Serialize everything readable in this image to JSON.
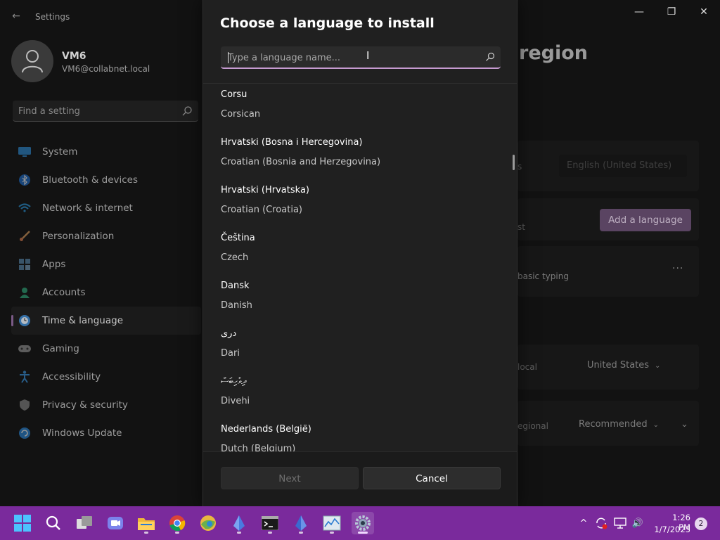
{
  "window": {
    "app_title": "Settings",
    "back_glyph": "←",
    "minimize_glyph": "—",
    "restore_glyph": "❐",
    "close_glyph": "✕"
  },
  "user": {
    "name": "VM6",
    "email": "VM6@collabnet.local"
  },
  "find": {
    "placeholder": "Find a setting"
  },
  "sidebar": {
    "items": [
      {
        "label": "System",
        "icon": "monitor-icon"
      },
      {
        "label": "Bluetooth & devices",
        "icon": "bluetooth-icon"
      },
      {
        "label": "Network & internet",
        "icon": "wifi-icon"
      },
      {
        "label": "Personalization",
        "icon": "brush-icon"
      },
      {
        "label": "Apps",
        "icon": "apps-icon"
      },
      {
        "label": "Accounts",
        "icon": "person-icon"
      },
      {
        "label": "Time & language",
        "icon": "globe-clock-icon",
        "active": true
      },
      {
        "label": "Gaming",
        "icon": "gamepad-icon"
      },
      {
        "label": "Accessibility",
        "icon": "accessibility-icon"
      },
      {
        "label": "Privacy & security",
        "icon": "shield-icon"
      },
      {
        "label": "Windows Update",
        "icon": "update-icon"
      }
    ]
  },
  "background_page": {
    "heading_fragment": "region",
    "display_lang_fragment": "s",
    "display_lang_value": "English (United States)",
    "preferred_fragment": "st",
    "add_language_label": "Add a language",
    "basic_typing_fragment": "basic typing",
    "more_glyph": "···",
    "country_fragment": "local",
    "country_value": "United States",
    "regional_fragment": "egional",
    "regional_value": "Recommended",
    "chevron_glyph": "⌄"
  },
  "dialog": {
    "title": "Choose a language to install",
    "search_placeholder": "Type a language name...",
    "ibeam_glyph": "I",
    "languages": [
      {
        "native": "Corsu",
        "english": "Corsican"
      },
      {
        "native": "Hrvatski (Bosna i Hercegovina)",
        "english": "Croatian (Bosnia and Herzegovina)"
      },
      {
        "native": "Hrvatski (Hrvatska)",
        "english": "Croatian (Croatia)"
      },
      {
        "native": "Čeština",
        "english": "Czech"
      },
      {
        "native": "Dansk",
        "english": "Danish"
      },
      {
        "native": "دری",
        "english": "Dari"
      },
      {
        "native": "ދިވެހިބަސް",
        "english": "Divehi"
      },
      {
        "native": "Nederlands (België)",
        "english": "Dutch (Belgium)"
      }
    ],
    "next_label": "Next",
    "cancel_label": "Cancel"
  },
  "taskbar": {
    "apps": [
      "windows-start-icon",
      "search-icon",
      "task-view-icon",
      "teams-chat-icon",
      "file-explorer-icon",
      "chrome-icon",
      "edge-canary-icon",
      "app-icon",
      "terminal-icon",
      "app-icon-2",
      "resource-monitor-icon",
      "settings-gear-icon"
    ],
    "time": "1:26 PM",
    "date": "1/7/2023",
    "notifications": "2",
    "tray_chevron_glyph": "^",
    "speaker_glyph": "🔊"
  },
  "colors": {
    "accent": "#c69bd1",
    "taskbar": "#7a2a9c",
    "dialog_bg": "#202020",
    "add_button": "#5a4462"
  }
}
